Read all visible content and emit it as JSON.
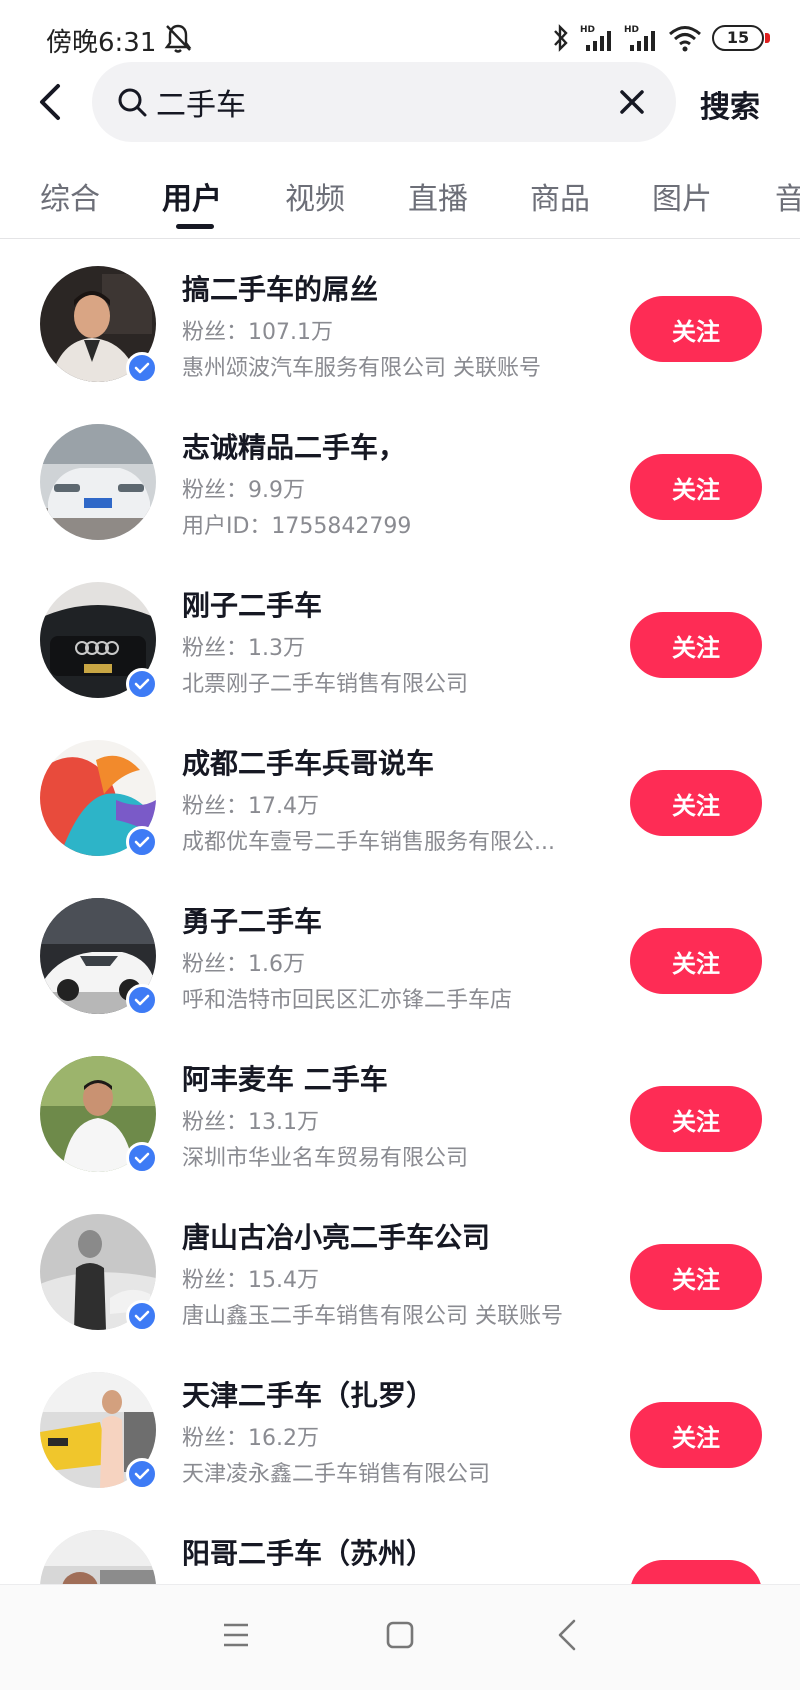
{
  "status": {
    "time": "傍晚6:31",
    "battery": "15",
    "hd1": "HD",
    "hd2": "HD"
  },
  "search": {
    "query": "二手车",
    "button": "搜索"
  },
  "tabs": [
    {
      "label": "综合"
    },
    {
      "label": "用户"
    },
    {
      "label": "视频"
    },
    {
      "label": "直播"
    },
    {
      "label": "商品"
    },
    {
      "label": "图片"
    },
    {
      "label": "音"
    }
  ],
  "active_tab": "用户",
  "users": [
    {
      "name": "搞二手车的屌丝",
      "fans": "粉丝：107.1万",
      "desc": "惠州颂波汽车服务有限公司 关联账号",
      "follow": "关注",
      "verified": true
    },
    {
      "name": "志诚精品二手车，",
      "fans": "粉丝：9.9万",
      "desc": "用户ID：1755842799",
      "follow": "关注",
      "verified": false
    },
    {
      "name": "刚子二手车",
      "fans": "粉丝：1.3万",
      "desc": "北票刚子二手车销售有限公司",
      "follow": "关注",
      "verified": true
    },
    {
      "name": "成都二手车兵哥说车",
      "fans": "粉丝：17.4万",
      "desc": "成都优车壹号二手车销售服务有限公...",
      "follow": "关注",
      "verified": true
    },
    {
      "name": "勇子二手车",
      "fans": "粉丝：1.6万",
      "desc": "呼和浩特市回民区汇亦锋二手车店",
      "follow": "关注",
      "verified": true
    },
    {
      "name": "阿丰麦车 二手车",
      "fans": "粉丝：13.1万",
      "desc": "深圳市华业名车贸易有限公司",
      "follow": "关注",
      "verified": true
    },
    {
      "name": "唐山古冶小亮二手车公司",
      "fans": "粉丝：15.4万",
      "desc": "唐山鑫玉二手车销售有限公司 关联账号",
      "follow": "关注",
      "verified": true
    },
    {
      "name": "天津二手车（扎罗）",
      "fans": "粉丝：16.2万",
      "desc": "天津凌永鑫二手车销售有限公司",
      "follow": "关注",
      "verified": true
    },
    {
      "name": "阳哥二手车（苏州）",
      "fans": "",
      "desc": "",
      "follow": "",
      "verified": false
    }
  ],
  "colors": {
    "accent": "#fe2c55",
    "verified": "#3e7bf5",
    "text": "#161823",
    "secondary": "#8a8b91"
  },
  "icons": {
    "back": "back-arrow-icon",
    "search": "search-icon",
    "clear": "close-icon",
    "nav_menu": "menu-icon",
    "nav_home": "home-icon",
    "nav_back": "back-icon"
  }
}
